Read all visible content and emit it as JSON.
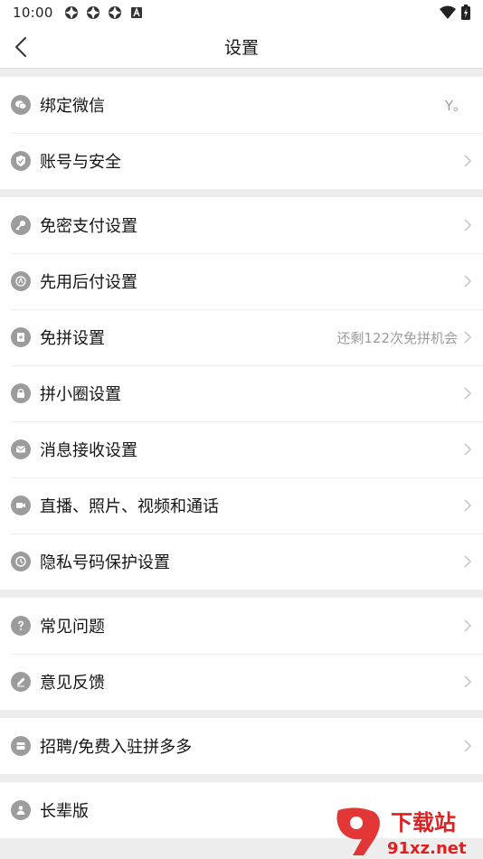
{
  "status_bar": {
    "time": "10:00",
    "icons": [
      "app-icon",
      "app-icon",
      "app-icon",
      "a-icon"
    ],
    "right_icons": [
      "wifi-icon",
      "battery-icon"
    ]
  },
  "nav": {
    "title": "设置",
    "back_icon": "chevron-left-icon"
  },
  "groups": [
    {
      "items": [
        {
          "label": "绑定微信",
          "value": "Y。",
          "icon": "wechat-icon",
          "chevron": false
        },
        {
          "label": "账号与安全",
          "value": "",
          "icon": "shield-icon",
          "chevron": true
        }
      ]
    },
    {
      "items": [
        {
          "label": "免密支付设置",
          "value": "",
          "icon": "key-icon",
          "chevron": true
        },
        {
          "label": "先用后付设置",
          "value": "",
          "icon": "badge-icon",
          "chevron": true
        },
        {
          "label": "免拼设置",
          "value": "还剩122次免拼机会",
          "icon": "coupon-icon",
          "chevron": true
        },
        {
          "label": "拼小圈设置",
          "value": "",
          "icon": "lock-icon",
          "chevron": true
        },
        {
          "label": "消息接收设置",
          "value": "",
          "icon": "mail-icon",
          "chevron": true
        },
        {
          "label": "直播、照片、视频和通话",
          "value": "",
          "icon": "camera-icon",
          "chevron": true
        },
        {
          "label": "隐私号码保护设置",
          "value": "",
          "icon": "phone-icon",
          "chevron": true
        }
      ]
    },
    {
      "items": [
        {
          "label": "常见问题",
          "value": "",
          "icon": "question-icon",
          "chevron": true
        },
        {
          "label": "意见反馈",
          "value": "",
          "icon": "pencil-icon",
          "chevron": true
        }
      ]
    },
    {
      "items": [
        {
          "label": "招聘/免费入驻拼多多",
          "value": "",
          "icon": "store-icon",
          "chevron": true
        }
      ]
    },
    {
      "items": [
        {
          "label": "长辈版",
          "value": "",
          "icon": "elder-icon",
          "chevron": false
        }
      ]
    }
  ],
  "watermark": {
    "text": "下载站",
    "domain": "91xz.net",
    "colors": {
      "brand": "#e02020"
    }
  },
  "colors": {
    "background": "#ededed",
    "surface": "#ffffff",
    "text": "#151516",
    "secondary": "#9c9c9c"
  }
}
